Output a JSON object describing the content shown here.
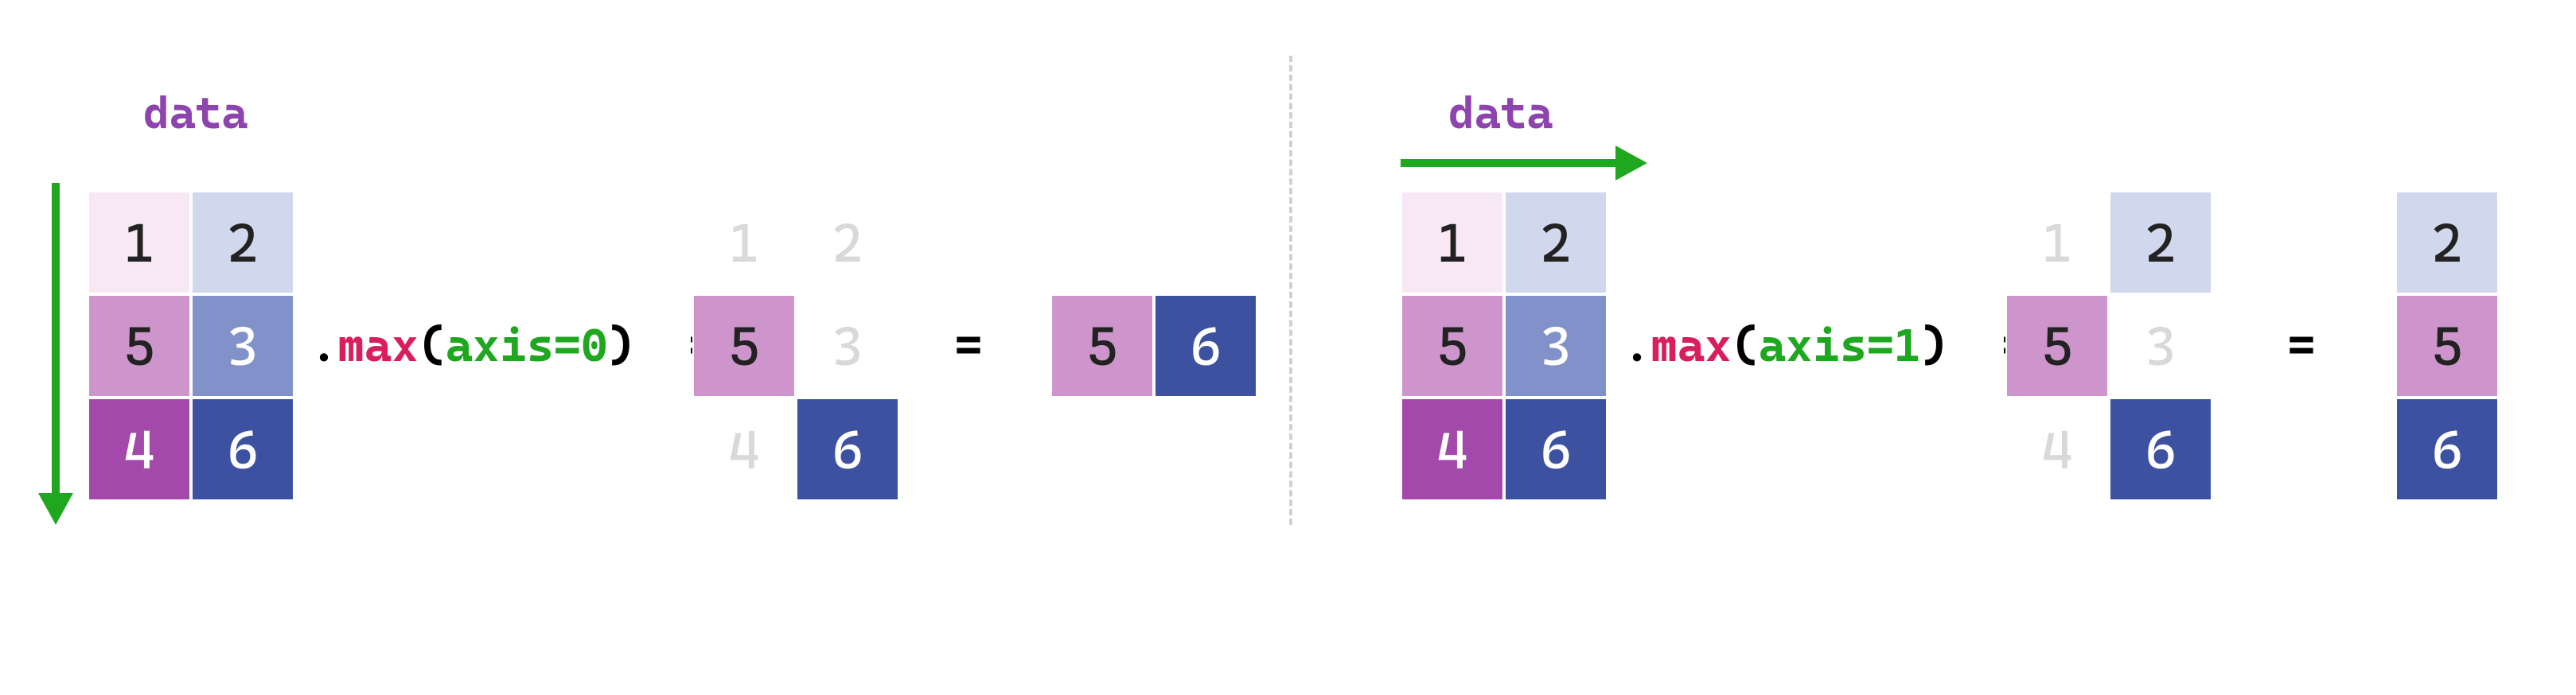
{
  "global": {
    "label_data": "data",
    "equals": "=",
    "dot": ".",
    "method": "max",
    "paren_open": "(",
    "paren_close": ")"
  },
  "left": {
    "axis_text": "axis=0",
    "matrix": [
      "1",
      "2",
      "5",
      "3",
      "4",
      "6"
    ],
    "fadedText": [
      "1",
      "2",
      "5",
      "3",
      "4",
      "6"
    ],
    "result": [
      "5",
      "6"
    ]
  },
  "right": {
    "axis_text": "axis=1",
    "matrix": [
      "1",
      "2",
      "5",
      "3",
      "4",
      "6"
    ],
    "fadedText": [
      "1",
      "2",
      "5",
      "3",
      "4",
      "6"
    ],
    "result": [
      "2",
      "5",
      "6"
    ]
  },
  "chart_data": {
    "type": "table",
    "description": "illustration of numpy-style .max over axis 0 vs axis 1",
    "input_matrix": [
      [
        1,
        2
      ],
      [
        5,
        3
      ],
      [
        4,
        6
      ]
    ],
    "axis0": {
      "winners_mask": [
        [
          0,
          0
        ],
        [
          1,
          0
        ],
        [
          0,
          1
        ]
      ],
      "result": [
        5,
        6
      ]
    },
    "axis1": {
      "winners_mask": [
        [
          0,
          1
        ],
        [
          1,
          0
        ],
        [
          0,
          1
        ]
      ],
      "result": [
        2,
        5,
        6
      ]
    }
  }
}
